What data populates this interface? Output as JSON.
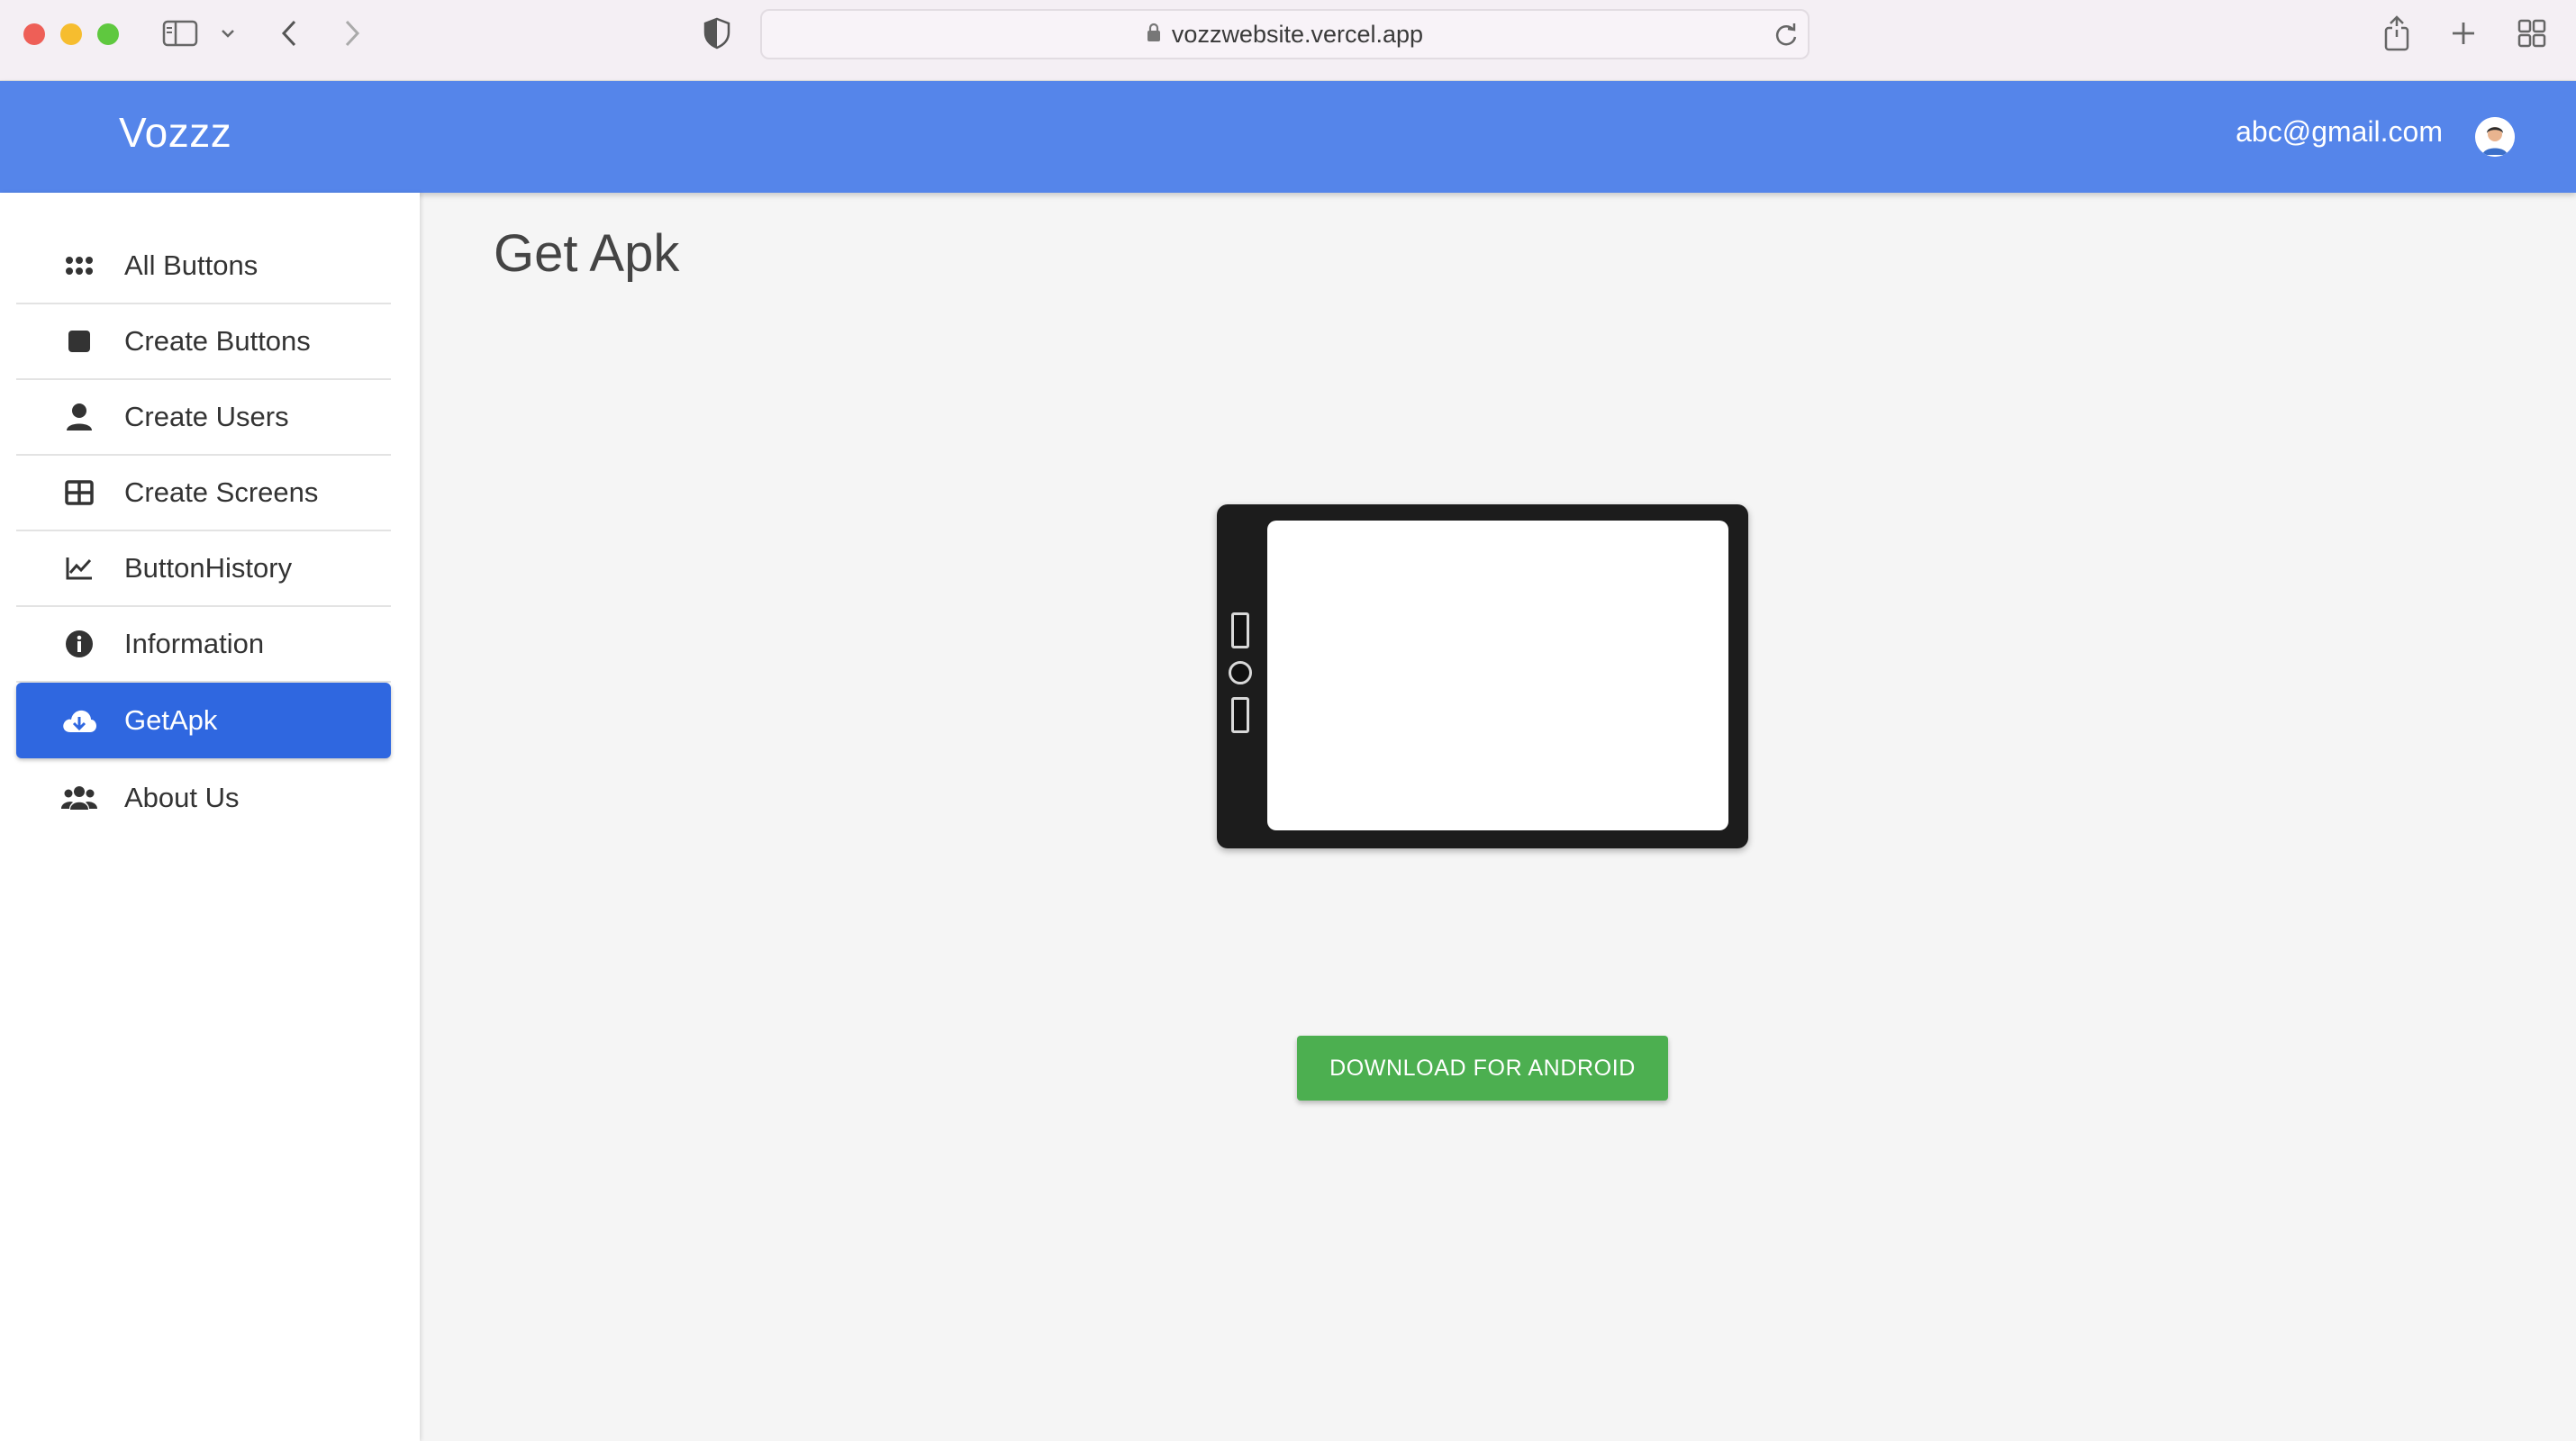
{
  "browser": {
    "url": "vozzwebsite.vercel.app",
    "icons": [
      "sidebar-toggle-icon",
      "chevron-down-icon",
      "back-icon",
      "forward-icon",
      "shield-icon",
      "lock-icon",
      "reload-icon",
      "share-icon",
      "new-tab-icon",
      "tab-overview-icon"
    ]
  },
  "header": {
    "brand": "Vozzz",
    "user_email": "abc@gmail.com",
    "color": "#5585ea"
  },
  "sidebar": {
    "items": [
      {
        "label": "All Buttons",
        "icon": "apps-grid-icon"
      },
      {
        "label": "Create Buttons",
        "icon": "square-icon"
      },
      {
        "label": "Create Users",
        "icon": "person-icon"
      },
      {
        "label": "Create Screens",
        "icon": "table-icon"
      },
      {
        "label": "ButtonHistory",
        "icon": "line-chart-icon"
      },
      {
        "label": "Information",
        "icon": "info-icon"
      },
      {
        "label": "GetApk",
        "icon": "cloud-download-icon",
        "active": true
      },
      {
        "label": "About Us",
        "icon": "group-icon"
      }
    ],
    "active_color": "#2f67e0"
  },
  "main": {
    "title": "Get Apk",
    "download_label": "DOWNLOAD FOR ANDROID",
    "download_color": "#4caf50"
  }
}
